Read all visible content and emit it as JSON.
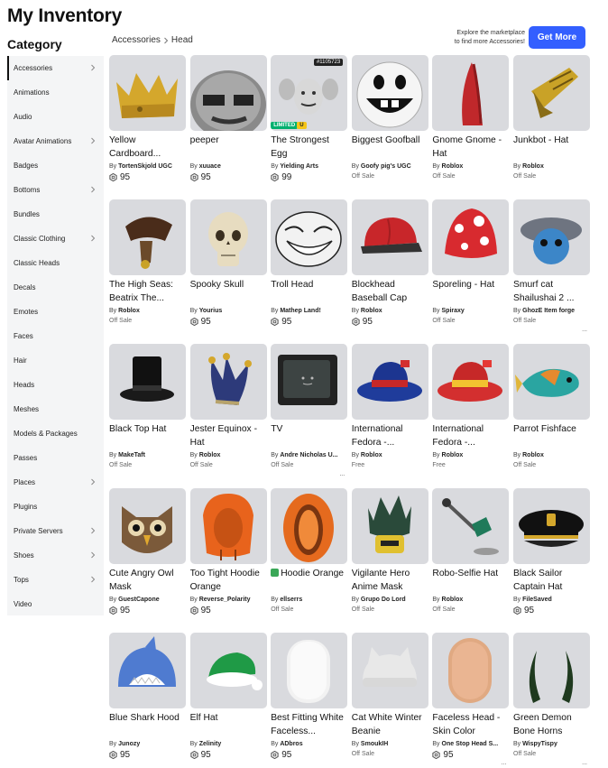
{
  "page": {
    "title": "My Inventory",
    "category_heading": "Category"
  },
  "sidebar": {
    "items": [
      {
        "label": "Accessories",
        "chevron": true,
        "active": true
      },
      {
        "label": "Animations",
        "chevron": false
      },
      {
        "label": "Audio",
        "chevron": false
      },
      {
        "label": "Avatar Animations",
        "chevron": true
      },
      {
        "label": "Badges",
        "chevron": false
      },
      {
        "label": "Bottoms",
        "chevron": true
      },
      {
        "label": "Bundles",
        "chevron": false
      },
      {
        "label": "Classic Clothing",
        "chevron": true
      },
      {
        "label": "Classic Heads",
        "chevron": false
      },
      {
        "label": "Decals",
        "chevron": false
      },
      {
        "label": "Emotes",
        "chevron": false
      },
      {
        "label": "Faces",
        "chevron": false
      },
      {
        "label": "Hair",
        "chevron": false
      },
      {
        "label": "Heads",
        "chevron": false
      },
      {
        "label": "Meshes",
        "chevron": false
      },
      {
        "label": "Models & Packages",
        "chevron": false
      },
      {
        "label": "Passes",
        "chevron": false
      },
      {
        "label": "Places",
        "chevron": true
      },
      {
        "label": "Plugins",
        "chevron": false
      },
      {
        "label": "Private Servers",
        "chevron": true
      },
      {
        "label": "Shoes",
        "chevron": true
      },
      {
        "label": "Tops",
        "chevron": true
      },
      {
        "label": "Video",
        "chevron": false
      }
    ]
  },
  "breadcrumb": {
    "root": "Accessories",
    "current": "Head"
  },
  "promo": {
    "line1": "Explore the marketplace",
    "line2": "to find more Accessories!",
    "button": "Get More"
  },
  "price_prefix": "By",
  "items": [
    {
      "name": "Yellow Cardboard...",
      "creator": "TortenSkjold UGC",
      "price": "95",
      "icon": "yellow-crown-icon"
    },
    {
      "name": "peeper",
      "creator": "xuuace",
      "price": "95",
      "icon": "peeper-face-icon"
    },
    {
      "name": "The Strongest Egg",
      "creator": "Yielding Arts",
      "price": "99",
      "icon": "strong-egg-icon",
      "serial": "#1105723",
      "limited": "LIMITED",
      "limited_u": "U"
    },
    {
      "name": "Biggest Goofball",
      "creator": "Goofy pig's UGC",
      "status": "Off Sale",
      "icon": "goofball-icon"
    },
    {
      "name": "Gnome Gnome - Hat",
      "creator": "Roblox",
      "status": "Off Sale",
      "icon": "gnome-hat-icon"
    },
    {
      "name": "Junkbot - Hat",
      "creator": "Roblox",
      "status": "Off Sale",
      "icon": "junkbot-hat-icon"
    },
    {
      "name": "The High Seas: Beatrix The...",
      "creator": "Roblox",
      "status": "Off Sale",
      "icon": "pirate-hat-icon"
    },
    {
      "name": "Spooky Skull",
      "creator": "Yourius",
      "price": "95",
      "icon": "skull-icon"
    },
    {
      "name": "Troll Head",
      "creator": "Mathep Land!",
      "price": "95",
      "icon": "troll-face-icon"
    },
    {
      "name": "Blockhead Baseball Cap",
      "creator": "Roblox",
      "price": "95",
      "icon": "baseball-cap-icon"
    },
    {
      "name": "Sporeling - Hat",
      "creator": "Spiraxy",
      "status": "Off Sale",
      "icon": "mushroom-hat-icon"
    },
    {
      "name": "Smurf cat Shailushai 2 ...",
      "creator": "GhozE Item forge",
      "status": "Off Sale",
      "icon": "smurf-cat-icon",
      "more": "..."
    },
    {
      "name": "Black Top Hat",
      "creator": "MakeTaft",
      "status": "Off Sale",
      "icon": "top-hat-icon"
    },
    {
      "name": "Jester Equinox - Hat",
      "creator": "Roblox",
      "status": "Off Sale",
      "icon": "jester-hat-icon"
    },
    {
      "name": "TV",
      "creator": "Andre Nicholas U...",
      "status": "Off Sale",
      "icon": "tv-icon",
      "more": "..."
    },
    {
      "name": "International Fedora -...",
      "creator": "Roblox",
      "status": "Free",
      "icon": "fedora-blue-icon"
    },
    {
      "name": "International Fedora -...",
      "creator": "Roblox",
      "status": "Free",
      "icon": "fedora-red-icon"
    },
    {
      "name": "Parrot Fishface",
      "creator": "Roblox",
      "status": "Off Sale",
      "icon": "parrot-fish-icon"
    },
    {
      "name": "Cute Angry Owl Mask",
      "creator": "GuestCapone",
      "price": "95",
      "icon": "owl-mask-icon"
    },
    {
      "name": "Too Tight Hoodie Orange",
      "creator": "Reverse_Polarity",
      "price": "95",
      "icon": "orange-hoodie-icon"
    },
    {
      "name": "Hoodie Orange",
      "creator": "ellserrs",
      "status": "Off Sale",
      "icon": "hoodie-orange-icon",
      "verified": true
    },
    {
      "name": "Vigilante Hero Anime Mask",
      "creator": "Grupo Do Lord",
      "status": "Off Sale",
      "icon": "hero-mask-icon"
    },
    {
      "name": "Robo-Selfie Hat",
      "creator": "Roblox",
      "status": "Off Sale",
      "icon": "selfie-arm-icon"
    },
    {
      "name": "Black Sailor Captain Hat",
      "creator": "FileSaved",
      "price": "95",
      "icon": "captain-hat-icon"
    },
    {
      "name": "Blue Shark Hood",
      "creator": "Junozy",
      "price": "95",
      "icon": "shark-hood-icon"
    },
    {
      "name": "Elf Hat",
      "creator": "Zelinity",
      "price": "95",
      "icon": "elf-hat-icon"
    },
    {
      "name": "Best Fitting White Faceless...",
      "creator": "ADbros",
      "price": "95",
      "icon": "white-head-icon"
    },
    {
      "name": "Cat White Winter Beanie",
      "creator": "SmoukIH",
      "status": "Off Sale",
      "icon": "cat-beanie-icon"
    },
    {
      "name": "Faceless Head - Skin Color",
      "creator": "One Stop Head S...",
      "price": "95",
      "icon": "skin-head-icon",
      "more": "..."
    },
    {
      "name": "Green Demon Bone Horns",
      "creator": "WispyTispy",
      "status": "Off Sale",
      "icon": "demon-horns-icon",
      "more": "..."
    }
  ]
}
